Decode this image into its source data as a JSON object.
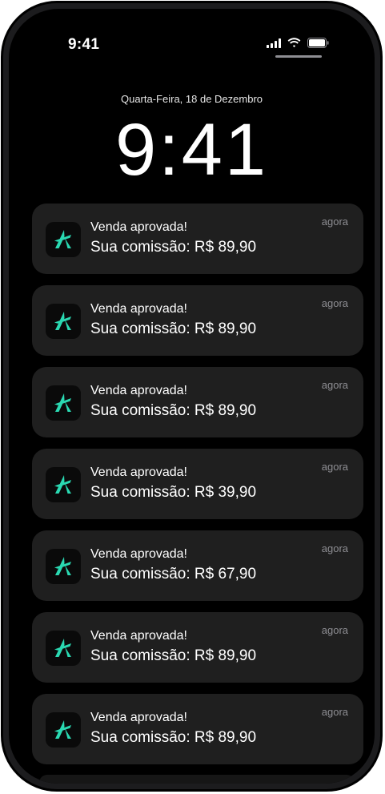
{
  "status_bar": {
    "time": "9:41"
  },
  "lock_screen": {
    "date": "Quarta-Feira, 18 de Dezembro",
    "time": "9:41"
  },
  "colors": {
    "accent": "#2ad9b2",
    "card": "#1f1f1f",
    "background": "#000000"
  },
  "notifications": [
    {
      "app_icon": "brand-logo-icon",
      "title": "Venda aprovada!",
      "body": "Sua comissão: R$ 89,90",
      "time": "agora"
    },
    {
      "app_icon": "brand-logo-icon",
      "title": "Venda aprovada!",
      "body": "Sua comissão: R$ 89,90",
      "time": "agora"
    },
    {
      "app_icon": "brand-logo-icon",
      "title": "Venda aprovada!",
      "body": "Sua comissão: R$ 89,90",
      "time": "agora"
    },
    {
      "app_icon": "brand-logo-icon",
      "title": "Venda aprovada!",
      "body": "Sua comissão: R$ 39,90",
      "time": "agora"
    },
    {
      "app_icon": "brand-logo-icon",
      "title": "Venda aprovada!",
      "body": "Sua comissão: R$ 67,90",
      "time": "agora"
    },
    {
      "app_icon": "brand-logo-icon",
      "title": "Venda aprovada!",
      "body": "Sua comissão: R$ 89,90",
      "time": "agora"
    },
    {
      "app_icon": "brand-logo-icon",
      "title": "Venda aprovada!",
      "body": "Sua comissão: R$ 89,90",
      "time": "agora"
    }
  ]
}
